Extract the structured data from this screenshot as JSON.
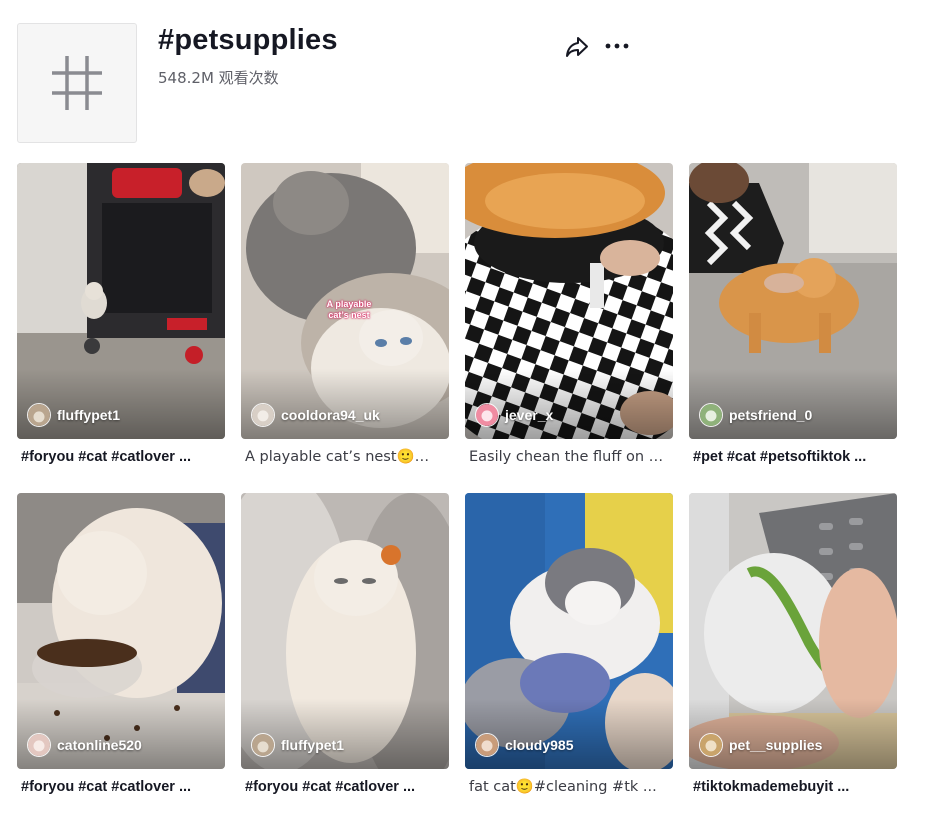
{
  "header": {
    "title": "#petsupplies",
    "views": "548.2M 观看次数",
    "icon": "hashtag-icon",
    "share_icon": "share-icon",
    "more_icon": "more-icon"
  },
  "videos": [
    {
      "username": "fluffypet1",
      "caption": "#foryou #cat #catlover ...",
      "style": "tags"
    },
    {
      "username": "cooldora94_uk",
      "caption": "A playable cat’s nest🙂🙂...",
      "style": "plain",
      "overlay": "A playable cat’s nest"
    },
    {
      "username": "jever_x",
      "caption": "Easily chean the fluff on bl...",
      "style": "plain"
    },
    {
      "username": "petsfriend_0",
      "caption": "#pet #cat #petsoftiktok ...",
      "style": "tags"
    },
    {
      "username": "catonline520",
      "caption": "#foryou #cat #catlover ...",
      "style": "tags"
    },
    {
      "username": "fluffypet1",
      "caption": "#foryou #cat #catlover ...",
      "style": "tags"
    },
    {
      "username": "cloudy985",
      "caption": "fat cat🙂#cleaning #tk ...",
      "style": "plain"
    },
    {
      "username": "pet__supplies",
      "caption": "#tiktokmademebuyit ...",
      "style": "tags"
    }
  ]
}
